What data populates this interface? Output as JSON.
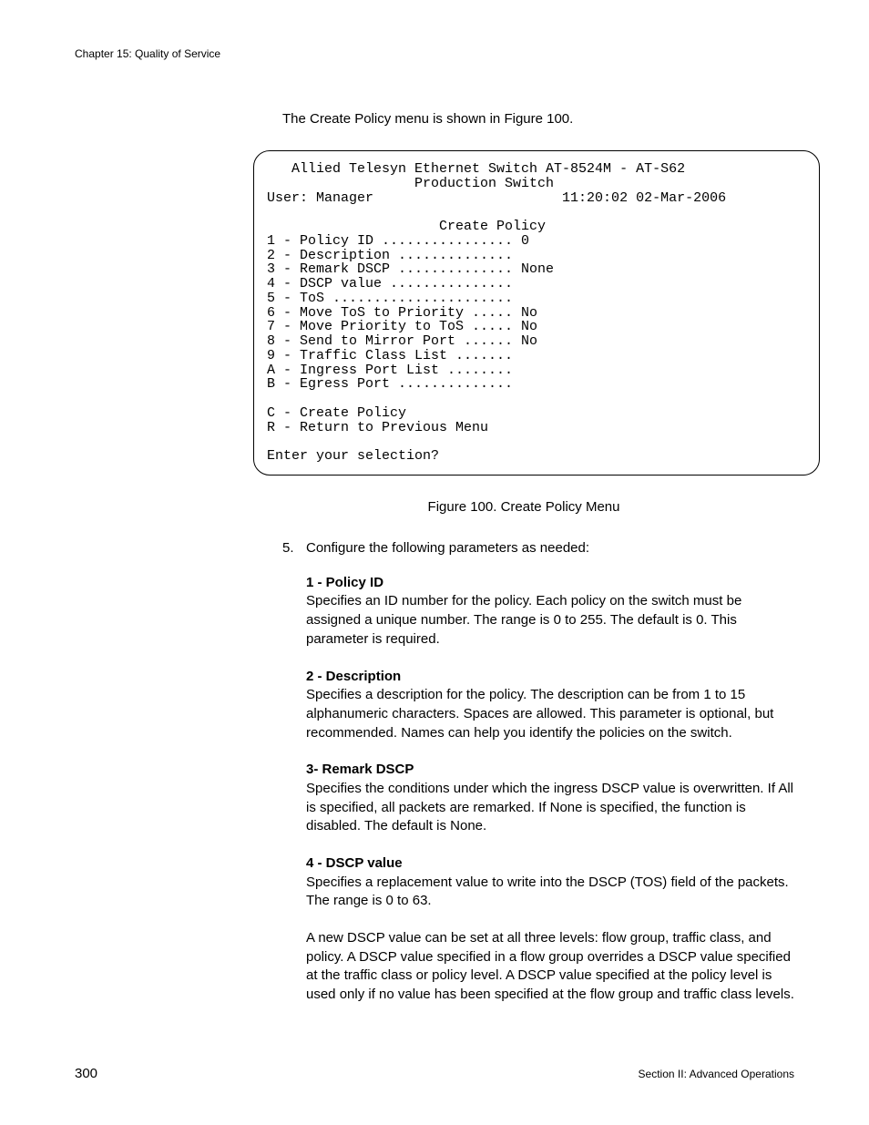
{
  "header": {
    "chapter": "Chapter 15: Quality of Service"
  },
  "intro": "The Create Policy menu is shown in Figure 100.",
  "terminal": "   Allied Telesyn Ethernet Switch AT-8524M - AT-S62\n                  Production Switch\nUser: Manager                       11:20:02 02-Mar-2006\n\n                     Create Policy\n1 - Policy ID ................ 0\n2 - Description ..............\n3 - Remark DSCP .............. None\n4 - DSCP value ...............\n5 - ToS ......................\n6 - Move ToS to Priority ..... No\n7 - Move Priority to ToS ..... No\n8 - Send to Mirror Port ...... No\n9 - Traffic Class List .......\nA - Ingress Port List ........\nB - Egress Port ..............\n\nC - Create Policy\nR - Return to Previous Menu\n\nEnter your selection?",
  "figure_caption": "Figure 100. Create Policy Menu",
  "step": {
    "num": "5.",
    "text": "Configure the following parameters as needed:"
  },
  "params": [
    {
      "head": "1 - Policy ID",
      "body": "Specifies an ID number for the policy. Each policy on the switch must be assigned a unique number. The range is 0 to 255. The default is 0. This parameter is required."
    },
    {
      "head": "2 - Description",
      "body": "Specifies a description for the policy. The description can be from 1 to 15 alphanumeric characters. Spaces are allowed. This parameter is optional, but recommended. Names can help you identify the policies on the switch."
    },
    {
      "head": "3- Remark DSCP",
      "body": "Specifies the conditions under which the ingress DSCP value is overwritten. If All is specified, all packets are remarked. If None is specified, the function is disabled. The default is None."
    },
    {
      "head": "4 - DSCP value",
      "body": "Specifies a replacement value to write into the DSCP (TOS) field of the packets. The range is 0 to 63."
    }
  ],
  "extra_para": "A new DSCP value can be set at all three levels: flow group, traffic class, and policy. A DSCP value specified in a flow group overrides a DSCP value specified at the traffic class or policy level. A DSCP value specified at the policy level is used only if no value has been specified at the flow group and traffic class levels.",
  "footer": {
    "page": "300",
    "section": "Section II: Advanced Operations"
  }
}
